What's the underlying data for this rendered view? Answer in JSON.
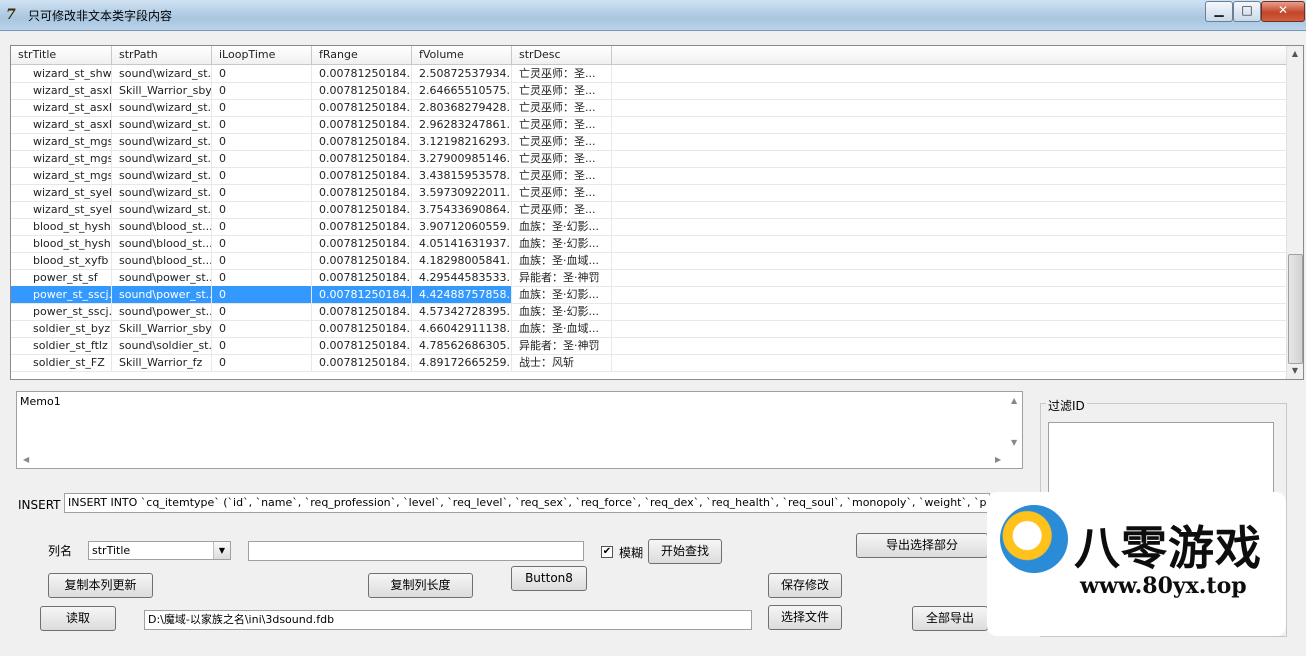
{
  "window": {
    "title": "只可修改非文本类字段内容",
    "icon_text": "7",
    "min_glyph": "▁",
    "max_glyph": "□",
    "close_glyph": "✕"
  },
  "grid": {
    "columns": [
      "strTitle",
      "strPath",
      "iLoopTime",
      "fRange",
      "fVolume",
      "strDesc"
    ],
    "rows": [
      [
        "wizard_st_shw...",
        "sound\\wizard_st...",
        "0",
        "0.00781250184...",
        "2.50872537934...",
        "亡灵巫师：圣..."
      ],
      [
        "wizard_st_asxl...",
        "Skill_Warrior_sbyz",
        "0",
        "0.00781250184...",
        "2.64665510575...",
        "亡灵巫师：圣..."
      ],
      [
        "wizard_st_asxl...",
        "sound\\wizard_st...",
        "0",
        "0.00781250184...",
        "2.80368279428...",
        "亡灵巫师：圣..."
      ],
      [
        "wizard_st_asxl...",
        "sound\\wizard_st...",
        "0",
        "0.00781250184...",
        "2.96283247861...",
        "亡灵巫师：圣..."
      ],
      [
        "wizard_st_mgs...",
        "sound\\wizard_st...",
        "0",
        "0.00781250184...",
        "3.12198216293...",
        "亡灵巫师：圣..."
      ],
      [
        "wizard_st_mgs...",
        "sound\\wizard_st...",
        "0",
        "0.00781250184...",
        "3.27900985146...",
        "亡灵巫师：圣..."
      ],
      [
        "wizard_st_mgs...",
        "sound\\wizard_st...",
        "0",
        "0.00781250184...",
        "3.43815953578...",
        "亡灵巫师：圣..."
      ],
      [
        "wizard_st_syel...",
        "sound\\wizard_st...",
        "0",
        "0.00781250184...",
        "3.59730922011...",
        "亡灵巫师：圣..."
      ],
      [
        "wizard_st_syel...",
        "sound\\wizard_st...",
        "0",
        "0.00781250184...",
        "3.75433690864...",
        "亡灵巫师：圣..."
      ],
      [
        "blood_st_hysh...",
        "sound\\blood_st...",
        "0",
        "0.00781250184...",
        "3.90712060559...",
        "血族：圣·幻影..."
      ],
      [
        "blood_st_hysh...",
        "sound\\blood_st...",
        "0",
        "0.00781250184...",
        "4.05141631937...",
        "血族：圣·幻影..."
      ],
      [
        "blood_st_xyfb",
        "sound\\blood_st...",
        "0",
        "0.00781250184...",
        "4.18298005841...",
        "血族：圣·血域..."
      ],
      [
        "power_st_sf",
        "sound\\power_st...",
        "0",
        "0.00781250184...",
        "4.29544583533...",
        "异能者：圣·神罚"
      ],
      [
        "power_st_sscj...",
        "sound\\power_st...",
        "0",
        "0.00781250184...",
        "4.42488757858...",
        "血族：圣·幻影..."
      ],
      [
        "power_st_sscj...",
        "sound\\power_st...",
        "0",
        "0.00781250184...",
        "4.57342728395...",
        "血族：圣·幻影..."
      ],
      [
        "soldier_st_byz",
        "Skill_Warrior_sbyz",
        "0",
        "0.00781250184...",
        "4.66042911138...",
        "血族：圣·血域..."
      ],
      [
        "soldier_st_ftlz",
        "sound\\soldier_st...",
        "0",
        "0.00781250184...",
        "4.78562686305...",
        "异能者：圣·神罚"
      ],
      [
        "soldier_st_FZ",
        "Skill_Warrior_fz",
        "0",
        "0.00781250184...",
        "4.89172665259...",
        "战士：风斩"
      ]
    ],
    "selected_row": 13,
    "scroll_up": "▲",
    "scroll_down": "▼"
  },
  "memo": {
    "text": "Memo1",
    "arrow_up": "▲",
    "arrow_down": "▼",
    "arrow_left": "◀",
    "arrow_right": "▶"
  },
  "filter": {
    "label": "过滤ID"
  },
  "insert": {
    "label": "INSERT",
    "value": "INSERT INTO `cq_itemtype` (`id`, `name`, `req_profession`, `level`, `req_level`, `req_sex`, `req_force`, `req_dex`, `req_health`, `req_soul`, `monopoly`, `weight`, `price`, `id_action`, `attack_max`, `attac"
  },
  "controls": {
    "column_label": "列名",
    "column_value": "strTitle",
    "combo_arrow": "▼",
    "search_value": "",
    "fuzzy_label": "模糊",
    "fuzzy_checked": "✔",
    "start_search": "开始查找",
    "export_selected": "导出选择部分",
    "copy_column_update": "复制本列更新",
    "copy_column_length": "复制列长度",
    "button8": "Button8",
    "save_changes": "保存修改",
    "read": "读取",
    "file_path": "D:\\魔域-以家族之名\\ini\\3dsound.fdb",
    "select_file": "选择文件",
    "export_all": "全部导出"
  },
  "watermark": {
    "brand": "八零游戏",
    "url": "www.80yx.top"
  }
}
